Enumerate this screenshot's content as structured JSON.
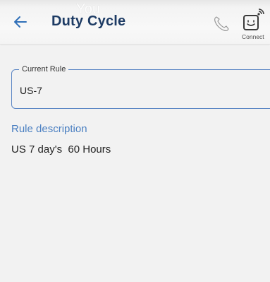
{
  "app_bar": {
    "overlay_text": "You",
    "title": "Duty Cycle",
    "connect_label": "Connect"
  },
  "current_rule": {
    "label": "Current Rule",
    "value": "US-7"
  },
  "rule_description": {
    "label": "Rule description",
    "value": "US 7 day's  60 Hours"
  },
  "colors": {
    "title": "#1d3b64",
    "accent": "#4a7fc1",
    "field_border": "#5b86c4",
    "background": "#f2f2f2"
  },
  "icons": [
    "back-arrow-icon",
    "phone-icon",
    "connect-device-icon"
  ]
}
